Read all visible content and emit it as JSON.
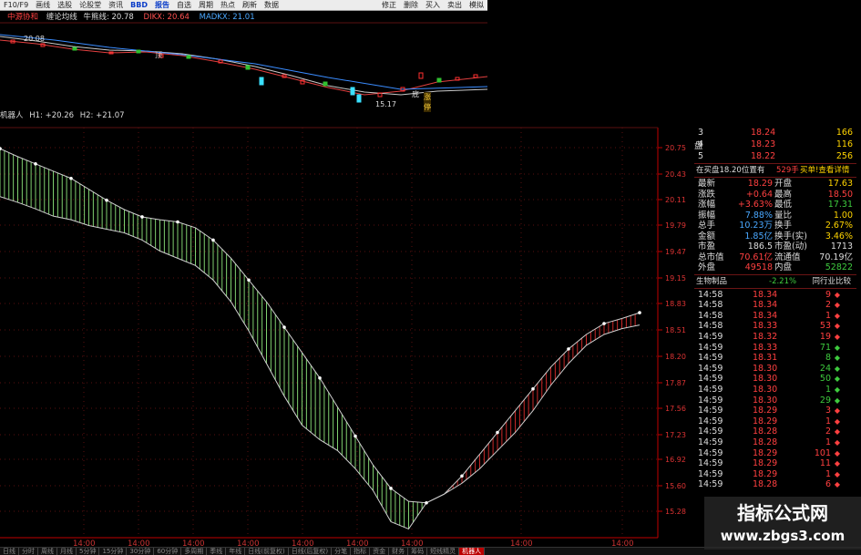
{
  "toolbar": {
    "items": [
      "F10/F9",
      "画线",
      "选股",
      "论股堂",
      "资讯",
      "BBD",
      "报告",
      "自选",
      "周期",
      "热点",
      "刷新",
      "数据"
    ],
    "right_items": [
      "修正",
      "删除",
      "买入",
      "卖出",
      "模拟"
    ]
  },
  "indicator1": {
    "name": "中源协和",
    "label1": "缠论均线",
    "label2": "牛熊线: 20.78",
    "label3": "DIKX: 20.64",
    "label4": "MADKX: 21.01",
    "price_high": "20.08",
    "price_low": "15.17",
    "tag1": "顶",
    "tag2": "底",
    "tag3": "涨停"
  },
  "indicator2": {
    "name": "机器人",
    "h1": "H1: +20.26",
    "h2": "H2: +21.07"
  },
  "y_axis": [
    "20.75",
    "20.43",
    "20.11",
    "19.79",
    "19.47",
    "19.15",
    "18.83",
    "18.51",
    "18.20",
    "17.87",
    "17.56",
    "17.23",
    "16.92",
    "15.60",
    "15.28"
  ],
  "x_axis": [
    "14:00",
    "14:00",
    "14:00",
    "14:00",
    "14:00",
    "14:00",
    "14:00",
    "14:00",
    "14:00"
  ],
  "quote": {
    "book": [
      {
        "lvl": "3",
        "price": "18.24",
        "vol": "166"
      },
      {
        "lvl": "4",
        "price": "18.23",
        "vol": "116"
      },
      {
        "lvl": "5",
        "price": "18.22",
        "vol": "256"
      }
    ],
    "side_label": "盘",
    "notice_left": "在买盘18.20位置有",
    "notice_mid": "529手",
    "notice_right": "买单!查看详情",
    "stats": [
      [
        "最新",
        "18.29",
        "开盘",
        "17.63"
      ],
      [
        "涨跌",
        "+0.64",
        "最高",
        "18.50"
      ],
      [
        "涨幅",
        "+3.63%",
        "最低",
        "17.31"
      ],
      [
        "振幅",
        "7.88%",
        "量比",
        "1.00"
      ],
      [
        "总手",
        "10.23万",
        "换手",
        "2.67%"
      ],
      [
        "金额",
        "1.85亿",
        "换手(实)",
        "3.46%"
      ],
      [
        "市盈",
        "186.5",
        "市盈(动)",
        "1713"
      ],
      [
        "总市值",
        "70.61亿",
        "流通值",
        "70.19亿"
      ],
      [
        "外盘",
        "49518",
        "内盘",
        "52822"
      ]
    ],
    "sector": "生物制品",
    "sector_pct": "-2.21%",
    "sector_btn": "同行业比较",
    "ticks": [
      [
        "14:58",
        "18.34",
        "9",
        "r"
      ],
      [
        "14:58",
        "18.34",
        "2",
        "r"
      ],
      [
        "14:58",
        "18.34",
        "1",
        "r"
      ],
      [
        "14:58",
        "18.33",
        "53",
        "r"
      ],
      [
        "14:59",
        "18.32",
        "19",
        "r"
      ],
      [
        "14:59",
        "18.33",
        "71",
        "g"
      ],
      [
        "14:59",
        "18.31",
        "8",
        "g"
      ],
      [
        "14:59",
        "18.30",
        "24",
        "g"
      ],
      [
        "14:59",
        "18.30",
        "50",
        "g"
      ],
      [
        "14:59",
        "18.30",
        "1",
        "g"
      ],
      [
        "14:59",
        "18.30",
        "29",
        "g"
      ],
      [
        "14:59",
        "18.29",
        "3",
        "r"
      ],
      [
        "14:59",
        "18.29",
        "1",
        "r"
      ],
      [
        "14:59",
        "18.28",
        "2",
        "r"
      ],
      [
        "14:59",
        "18.28",
        "1",
        "r"
      ],
      [
        "14:59",
        "18.29",
        "101",
        "r"
      ],
      [
        "14:59",
        "18.29",
        "11",
        "r"
      ],
      [
        "14:59",
        "18.29",
        "1",
        "r"
      ],
      [
        "14:59",
        "18.28",
        "6",
        "r"
      ]
    ]
  },
  "bottom_tabs": [
    "日线",
    "分时",
    "周线",
    "月线",
    "5分钟",
    "15分钟",
    "30分钟",
    "60分钟",
    "多周期",
    "季线",
    "年线",
    "日线(前复权)",
    "日线(后复权)",
    "分笔",
    "指标",
    "资金",
    "财务",
    "筹码",
    "短线精灵",
    "机器人"
  ],
  "watermark": {
    "line1": "指标公式网",
    "line2": "www.zbgs3.com"
  },
  "colors": {
    "up": "#e83030",
    "down": "#38c838",
    "up_fill": "#c82828",
    "down_fill": "#7fcf6f",
    "axis": "#c00000",
    "grid": "#5a1010"
  },
  "chart_data": {
    "type": "area",
    "upper": [
      20.56,
      20.45,
      20.35,
      20.25,
      20.15,
      20.0,
      19.85,
      19.72,
      19.62,
      19.58,
      19.55,
      19.47,
      19.3,
      19.05,
      18.75,
      18.45,
      18.1,
      17.75,
      17.4,
      17.0,
      16.6,
      16.2,
      15.88,
      15.7,
      15.68,
      15.8,
      16.05,
      16.35,
      16.65,
      16.95,
      17.25,
      17.55,
      17.8,
      18.0,
      18.15,
      18.22,
      18.3
    ],
    "lower": [
      19.9,
      19.82,
      19.73,
      19.63,
      19.58,
      19.5,
      19.45,
      19.4,
      19.3,
      19.15,
      19.05,
      18.95,
      18.75,
      18.45,
      18.05,
      17.6,
      17.15,
      16.75,
      16.55,
      16.4,
      16.15,
      15.85,
      15.42,
      15.32,
      15.68,
      15.8,
      15.95,
      16.15,
      16.4,
      16.65,
      16.95,
      17.3,
      17.6,
      17.85,
      18.0,
      18.08,
      18.13
    ],
    "ylim": [
      15.2,
      20.85
    ]
  }
}
